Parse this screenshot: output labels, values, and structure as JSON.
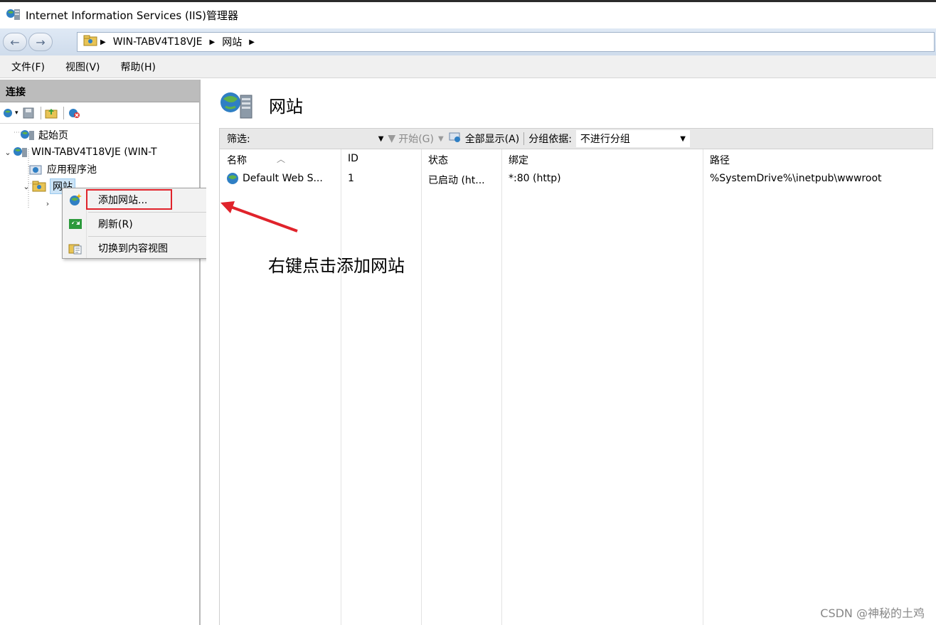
{
  "window": {
    "title": "Internet Information Services (IIS)管理器"
  },
  "address": {
    "crumbs": [
      "WIN-TABV4T18VJE",
      "网站"
    ]
  },
  "menu": {
    "file": "文件(F)",
    "view": "视图(V)",
    "help": "帮助(H)"
  },
  "connections": {
    "header": "连接",
    "tree": {
      "start_page": "起始页",
      "server": "WIN-TABV4T18VJE (WIN-T",
      "app_pools": "应用程序池",
      "sites": "网站"
    }
  },
  "context_menu": {
    "add_site": "添加网站...",
    "refresh": "刷新(R)",
    "switch_view": "切换到内容视图"
  },
  "main": {
    "title": "网站",
    "filter": {
      "label": "筛选:",
      "go": "开始(G)",
      "show_all": "全部显示(A)",
      "group_by_label": "分组依据:",
      "group_by_value": "不进行分组"
    },
    "columns": {
      "name": "名称",
      "id": "ID",
      "status": "状态",
      "binding": "绑定",
      "path": "路径"
    },
    "rows": [
      {
        "name": "Default Web S...",
        "id": "1",
        "status": "已启动 (ht...",
        "binding": "*:80 (http)",
        "path": "%SystemDrive%\\inetpub\\wwwroot"
      }
    ]
  },
  "annotation": "右键点击添加网站",
  "watermark": "CSDN @神秘的土鸡",
  "colors": {
    "highlight": "#e0232b",
    "address_bar": "#dfe9f5"
  }
}
